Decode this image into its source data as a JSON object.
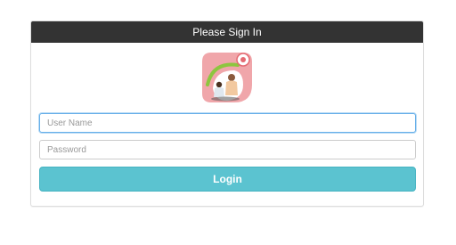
{
  "panel": {
    "title": "Please Sign In"
  },
  "logo": {
    "icon": "family-healthcare-logo-icon"
  },
  "form": {
    "username": {
      "placeholder": "User Name",
      "value": ""
    },
    "password": {
      "placeholder": "Password",
      "value": ""
    },
    "login_label": "Login"
  },
  "colors": {
    "header_bg": "#333333",
    "button_bg": "#5bc3d0",
    "focus_border": "#66afe9",
    "logo_pink": "#f0a6aa",
    "logo_green": "#8dc63f"
  }
}
